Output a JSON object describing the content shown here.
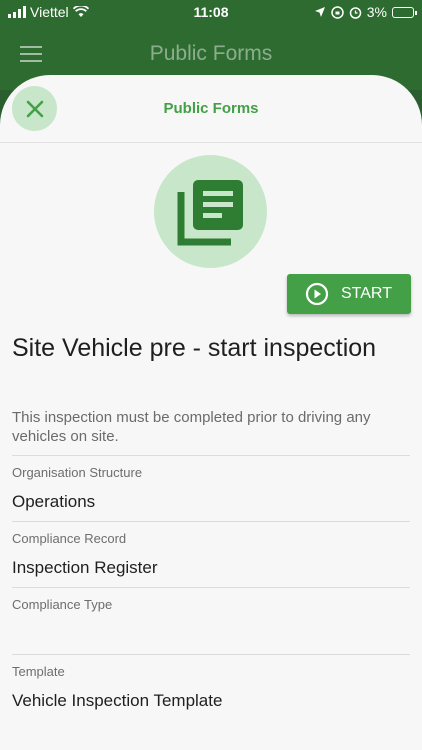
{
  "status_bar": {
    "carrier": "Viettel",
    "time": "11:08",
    "battery": "3%"
  },
  "app_bar": {
    "title": "Public Forms"
  },
  "sheet": {
    "title": "Public Forms",
    "start_label": "START",
    "form_title": "Site Vehicle pre - start inspection",
    "form_description": "This inspection must be completed prior to driving any vehicles on site.",
    "fields": [
      {
        "label": "Organisation Structure",
        "value": "Operations"
      },
      {
        "label": "Compliance Record",
        "value": "Inspection Register"
      },
      {
        "label": "Compliance Type",
        "value": ""
      },
      {
        "label": "Template",
        "value": "Vehicle Inspection Template"
      }
    ]
  },
  "colors": {
    "accent": "#43a047",
    "accent_light": "#c8e6c9",
    "header": "#2e6b30"
  }
}
